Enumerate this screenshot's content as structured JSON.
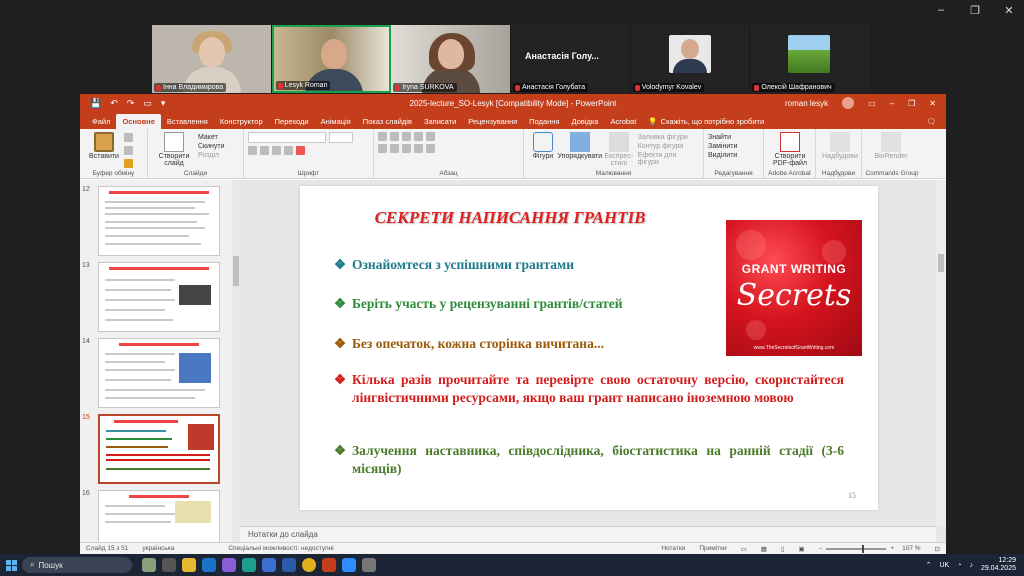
{
  "zoom_window": {
    "minimize": "–",
    "restore": "❐",
    "close": "✕"
  },
  "participants": [
    {
      "name": "Інна Владимирова",
      "type": "video",
      "bg": "#b9b3ac",
      "skin": "#e2c6b0",
      "shirt": "#d8d0c4"
    },
    {
      "name": "Lesyk Roman",
      "type": "video",
      "active": true,
      "bg": "#9c8a68",
      "skin": "#d7a98a",
      "shirt": "#3e4b5c"
    },
    {
      "name": "Iryna SURKOVA",
      "type": "video",
      "bg": "#a8a29a",
      "skin": "#e0b79f",
      "shirt": "#5a4a40"
    },
    {
      "name": "Анастасія Голубата",
      "type": "name",
      "display": "Анастасія Голу..."
    },
    {
      "name": "Volodymyr Kovalev",
      "type": "avatar"
    },
    {
      "name": "Олексій Шафранович",
      "type": "avatar-landscape"
    }
  ],
  "ppt": {
    "title": "2025-lecture_SO-Lesyk [Compatibility Mode]  -  PowerPoint",
    "user": "roman lesyk",
    "quick_access": [
      "💾",
      "↶",
      "↷",
      "▭",
      "▾"
    ],
    "window_buttons": [
      "▭",
      "–",
      "❐",
      "✕"
    ],
    "tabs": [
      "Файл",
      "Основне",
      "Вставлення",
      "Конструктор",
      "Переходи",
      "Анімація",
      "Показ слайдів",
      "Записати",
      "Рецензування",
      "Подання",
      "Довідка",
      "Acrobat"
    ],
    "active_tab": "Основне",
    "tell_me": "Скажіть, що потрібно зробити",
    "ribbon": {
      "clipboard": {
        "paste": "Вставити",
        "label": "Буфер обміну"
      },
      "slides": {
        "new_slide": "Створити слайд",
        "layout": "Макет",
        "reset": "Скинути",
        "section": "Розділ",
        "label": "Слайди"
      },
      "font": {
        "label": "Шрифт"
      },
      "paragraph": {
        "label": "Абзац"
      },
      "drawing": {
        "shapes": "Фігури",
        "arrange": "Упорядкувати",
        "quick_styles": "Експрес-стилі",
        "fill": "Заливка фігури",
        "outline": "Контур фігури",
        "effects": "Ефекти для фігури",
        "label": "Малювання"
      },
      "editing": {
        "find": "Знайти",
        "replace": "Замінити",
        "select": "Виділити",
        "label": "Редагування"
      },
      "acrobat": {
        "create": "Створити PDF-файл",
        "label": "Adobe Acrobat"
      },
      "send": {
        "send": "Надбудови",
        "label": "Надбудови"
      },
      "commands": {
        "biorender": "BioRender",
        "label": "Commands Group"
      }
    },
    "thumbnails": [
      {
        "num": "12",
        "title": "ЯКИЙ ЗМІСТ ГРАНТУ? ЯКА АНОТАЦІЯ?"
      },
      {
        "num": "13",
        "title": "П'ЯТЬ ОСНОВНИХ КРИТЕРІЇВ ОЦІНЮВАННЯ ГРАНТІВ"
      },
      {
        "num": "14",
        "title": "ПОРАДИ ЩОДО НАПИСАННЯ. ПІДГОТОВКА"
      },
      {
        "num": "15",
        "title": "СЕКРЕТИ НАПИСАННЯ ГРАНТІВ",
        "selected": true
      },
      {
        "num": "16",
        "title": "ПОРАДИ ЩОДО НАПИСАННЯ"
      }
    ],
    "slide": {
      "title": "СЕКРЕТИ НАПИСАННЯ ГРАНТІВ",
      "bullet_glyph": "❖",
      "bullets": [
        {
          "text": "Ознайомтеся з успішними грантами",
          "color": "#1f7a8c"
        },
        {
          "text": "Беріть участь у рецензуванні грантів/статей",
          "color": "#2e8b3a"
        },
        {
          "text": "Без опечаток, кожна сторінка вичитана...",
          "color": "#9a5b0a"
        },
        {
          "text": "Кілька разів прочитайте та перевірте свою остаточну версію, скористайтеся лінгвістичними ресурсами, якщо ваш грант написано іноземною мовою",
          "color": "#d31d1d"
        },
        {
          "text": "Залучення наставника, співдослідника, біостатистика на ранній стадії (3-6 місяців)",
          "color": "#4a7a2a"
        }
      ],
      "image": {
        "line1": "GRANT WRITING",
        "line2": "Secrets",
        "url": "www.TheSecretsofGrantWriting.com"
      },
      "page_number": "15"
    },
    "notes_label": "Нотатки до слайда",
    "status": {
      "slide_of": "Слайд 15 з 51",
      "language": "українська",
      "accessibility": "Спеціальні можливості: недоступні",
      "notes": "Нотатки",
      "comments": "Примітки",
      "zoom": "107 %"
    }
  },
  "taskbar": {
    "search": "Пошук",
    "lang": "UK",
    "time": "12:29",
    "date": "29.04.2025"
  }
}
